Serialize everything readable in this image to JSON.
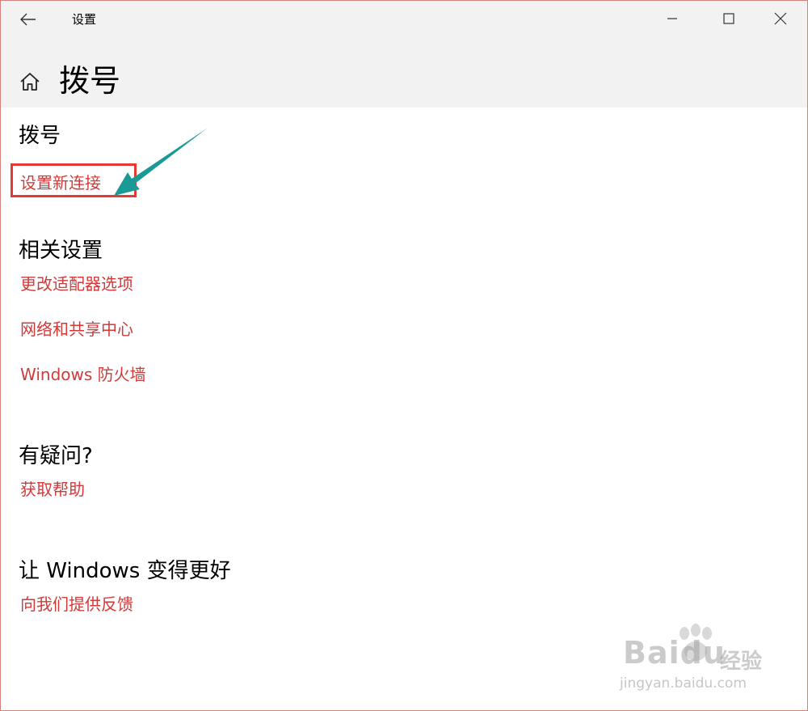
{
  "window": {
    "app_title": "设置"
  },
  "header": {
    "page_title": "拨号"
  },
  "dialup": {
    "section_title": "拨号",
    "new_connection_link": "设置新连接"
  },
  "related_settings": {
    "section_title": "相关设置",
    "links": [
      "更改适配器选项",
      "网络和共享中心",
      "Windows 防火墙"
    ]
  },
  "questions": {
    "section_title": "有疑问?",
    "help_link": "获取帮助"
  },
  "feedback": {
    "section_title": "让 Windows 变得更好",
    "feedback_link": "向我们提供反馈"
  },
  "watermark": {
    "brand": "Bai",
    "brand_suffix": "du",
    "sub": "经验",
    "url": "jingyan.baidu.com"
  },
  "icons": {
    "back": "back-arrow-icon",
    "home": "home-icon",
    "minimize": "minimize-icon",
    "maximize": "maximize-icon",
    "close": "close-icon"
  },
  "colors": {
    "link": "#d23a3a",
    "highlight": "#e53935",
    "annotation_arrow": "#1a9a96",
    "header_bg": "#f2f2f2"
  }
}
